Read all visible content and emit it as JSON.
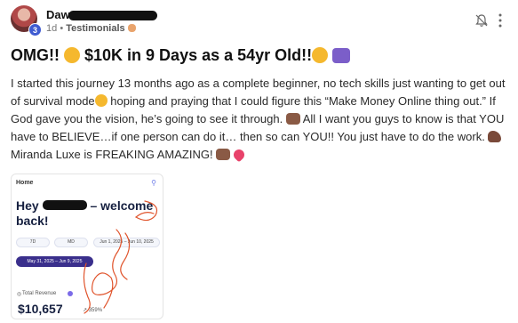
{
  "post": {
    "author_visible": "Daw",
    "level": "3",
    "time": "1d",
    "separator": "•",
    "category": "Testimonials",
    "title_parts": [
      "OMG!!",
      "$10K in 9 Days as a 54yr Old!!"
    ],
    "body": {
      "p1": "I started this journey 13 months ago as a complete beginner, no tech skills just wanting to get out of survival mode",
      "p2": " hoping and praying that I could figure this “Make Money Online thing out.” If God gave you the vision, he’s going to see it through.",
      "p3": " All I want you guys to know is that YOU have to BELIEVE…if one person can do it… then so can YOU!! You just have to do the work.",
      "p4": " Miranda Luxe is FREAKING AMAZING!"
    }
  },
  "icons": {
    "bell": "bell-off-icon",
    "more": "more-vertical-icon",
    "category_emoji": "clapping-hands-emoji",
    "link": "link-icon"
  },
  "dashboard": {
    "home": "Home",
    "greeting_start": "Hey",
    "greeting_end": "– welcome back!",
    "filters": [
      "7D",
      "MD",
      "Jun 1, 2025 – Jun 10, 2025"
    ],
    "active_range": "May 31, 2025 – Jun 9, 2025",
    "revenue_label": "Total Revenue",
    "revenue_value": "$10,657",
    "growth": "↗ 359%"
  },
  "colors": {
    "level_badge": "#3f5bd1",
    "active_pill": "#3a2f8c",
    "scribble": "#e0542c"
  }
}
